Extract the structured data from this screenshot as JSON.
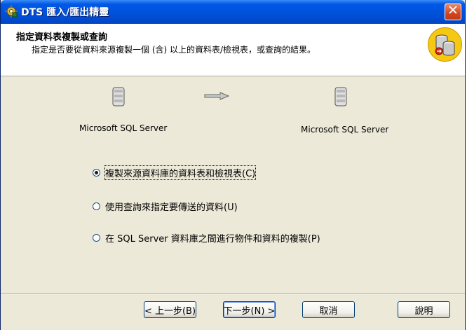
{
  "window": {
    "title": "DTS 匯入/匯出精靈",
    "close_glyph": "✕",
    "icon": "dts-wizard-icon"
  },
  "header": {
    "title": "指定資料表複製或查詢",
    "description": "指定是否要從資料來源複製一個 (含) 以上的資料表/檢視表，或查詢的結果。",
    "icon": "database-copy-icon"
  },
  "transfer": {
    "source_label": "Microsoft SQL Server",
    "destination_label": "Microsoft SQL Server",
    "source_icon": "database-server-icon",
    "destination_icon": "database-server-icon",
    "arrow_icon": "arrow-right-icon"
  },
  "options": [
    {
      "label": "複製來源資料庫的資料表和檢視表(C)",
      "selected": true
    },
    {
      "label": "使用查詢來指定要傳送的資料(U)",
      "selected": false
    },
    {
      "label": "在 SQL Server 資料庫之間進行物件和資料的複製(P)",
      "selected": false
    }
  ],
  "buttons": {
    "back": "< 上一步(B)",
    "next": "下一步(N) >",
    "cancel": "取消",
    "help": "說明"
  },
  "colors": {
    "titlebar": "#0050d8",
    "dialog_bg": "#ece9d8",
    "close_button": "#d3451f"
  }
}
